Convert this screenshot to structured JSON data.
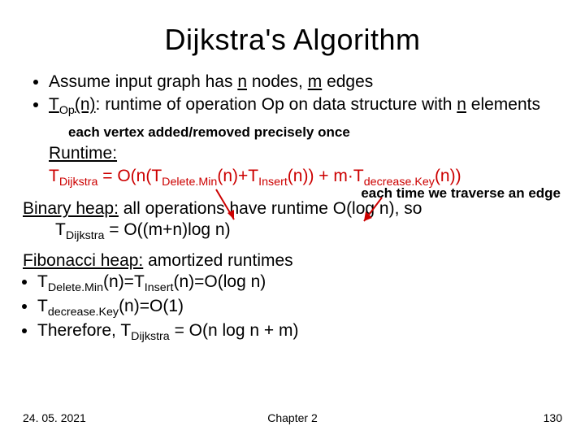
{
  "title": "Dijkstra's Algorithm",
  "bullet1_pre": "Assume input graph has ",
  "bullet1_n": "n",
  "bullet1_mid": " nodes, ",
  "bullet1_m": "m",
  "bullet1_post": " edges",
  "bullet2_pre": "T",
  "bullet2_op": "Op",
  "bullet2_mid": "(n): runtime of operation Op on data structure with ",
  "bullet2_n": "n",
  "bullet2_post": " elements",
  "note1": "each vertex added/removed precisely once",
  "note2": "each time we traverse an edge",
  "runtime_label": "Runtime:",
  "formula": {
    "lhs_T": "T",
    "lhs_sub": "Dijkstra",
    "eq": " = O(n(T",
    "del_sub": "Delete.Min",
    "mid1": "(n)+T",
    "ins_sub": "Insert",
    "mid2": "(n)) + m·T",
    "dec_sub": "decrease.Key",
    "tail": "(n))"
  },
  "binary_heap_label": "Binary heap:",
  "binary_heap_rest": " all operations have runtime O(log n), so",
  "binary_heap_line2_pre": "T",
  "binary_heap_line2_sub": "Dijkstra",
  "binary_heap_line2_rest": " = O((m+n)log n)",
  "fib_label": "Fibonacci heap:",
  "fib_rest": " amortized runtimes",
  "fib_b1_pre": "T",
  "fib_b1_sub1": "Delete.Min",
  "fib_b1_mid": "(n)=T",
  "fib_b1_sub2": "Insert",
  "fib_b1_tail": "(n)=O(log n)",
  "fib_b2_pre": "T",
  "fib_b2_sub": "decrease.Key",
  "fib_b2_tail": "(n)=O(1)",
  "fib_b3_pre": "Therefore, T",
  "fib_b3_sub": "Dijkstra",
  "fib_b3_tail": " = O(n log n + m)",
  "footer_date": "24. 05. 2021",
  "footer_chapter": "Chapter 2",
  "footer_page": "130"
}
